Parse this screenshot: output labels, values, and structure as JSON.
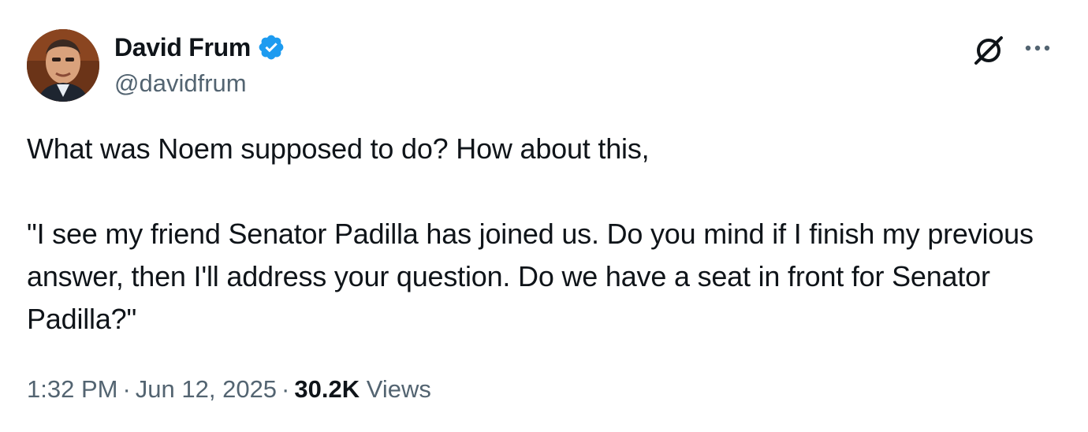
{
  "author": {
    "display_name": "David Frum",
    "handle": "@davidfrum",
    "verified": true,
    "verified_color": "#1d9bf0"
  },
  "tweet": {
    "paragraphs": [
      "What was Noem supposed to do? How about this,",
      "\"I see my friend Senator Padilla has joined us. Do you mind if I finish my previous answer, then I'll address your question. Do we have a seat in front for Senator Padilla?\""
    ],
    "time": "1:32 PM",
    "separator": "·",
    "date": "Jun 12, 2025",
    "views_count": "30.2K",
    "views_label": "Views"
  },
  "icons": {
    "grok": "grok-icon",
    "more": "more-options-icon",
    "verified": "verified-badge-icon"
  },
  "colors": {
    "text_primary": "#0f1419",
    "text_secondary": "#536471",
    "accent": "#1d9bf0"
  }
}
